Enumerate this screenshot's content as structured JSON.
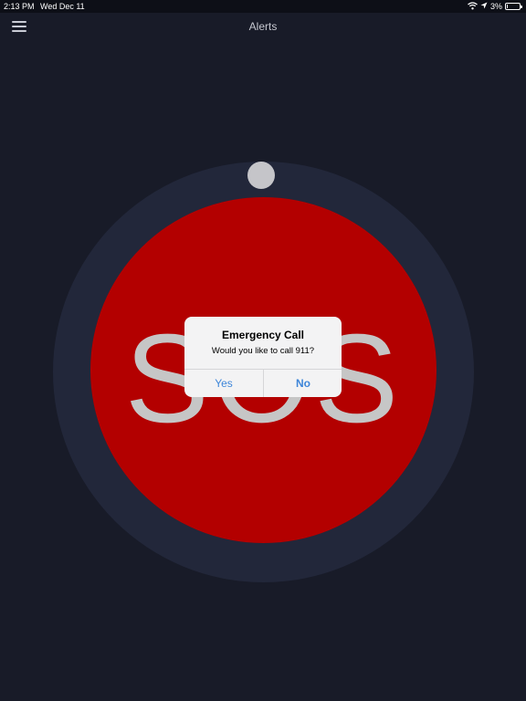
{
  "status_bar": {
    "time": "2:13 PM",
    "date": "Wed Dec 11",
    "battery": "3%",
    "battery_level": 0.03,
    "icons": [
      "wifi-icon",
      "location-arrow-icon",
      "battery-icon"
    ]
  },
  "nav": {
    "title": "Alerts",
    "menu_icon": "hamburger-menu-icon"
  },
  "sos": {
    "label": "SOS",
    "button_color": "#b30000",
    "ring_color": "#22273a",
    "knob_color": "#c5c5c9"
  },
  "alert": {
    "title": "Emergency Call",
    "message": "Would you like to call 911?",
    "yes_label": "Yes",
    "no_label": "No",
    "button_color": "#3e86d9"
  },
  "colors": {
    "background": "#181b28",
    "status_bar": "#0d0f17"
  }
}
